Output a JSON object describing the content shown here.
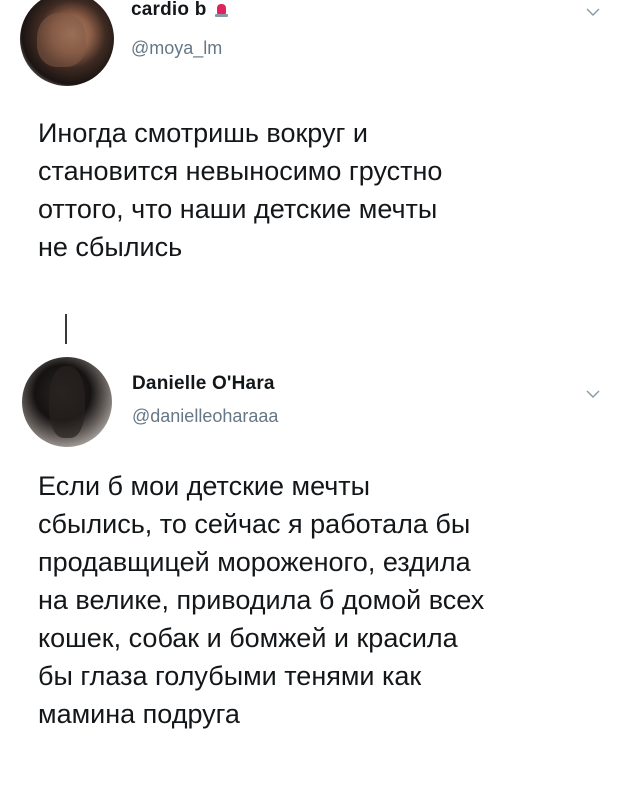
{
  "tweets": [
    {
      "display_name": "cardio b",
      "handle": "@moya_lm",
      "text": "Иногда смотришь вокруг и\nстановится невыносимо грустно\nоттого, что наши детские мечты\nне сбылись",
      "badge_icon": "siren-emoji-icon",
      "menu_icon": "chevron-down-icon"
    },
    {
      "display_name": "Danielle O'Hara",
      "handle": "@danielleoharaaa",
      "text": "Если б мои детские мечты\nсбылись, то сейчас я работала бы\nпродавщицей мороженого, ездила\nна велике, приводила б домой всех\nкошек, собак и бомжей и красила\nбы глаза голубыми тенями как\nмамина подруга",
      "menu_icon": "chevron-down-icon"
    }
  ],
  "colors": {
    "text_primary": "#14171a",
    "text_secondary": "#657786",
    "chevron": "#8899a6",
    "badge_red": "#e0245e",
    "background": "#ffffff"
  }
}
